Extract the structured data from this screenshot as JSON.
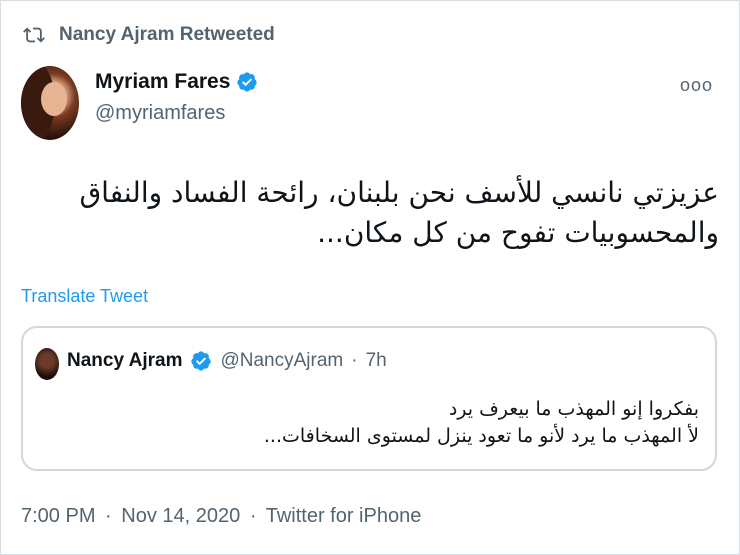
{
  "retweet_header": {
    "icon": "retweet-icon",
    "label": "Nancy Ajram Retweeted"
  },
  "author": {
    "display_name": "Myriam Fares",
    "handle": "@myriamfares",
    "verified": true
  },
  "more_menu": "ooo",
  "tweet": {
    "lines": [
      "عزيزتي نانسي للأسف نحن بلبنان، رائحة الفساد والنفاق",
      "والمحسوبيات تفوح من كل مكان..."
    ]
  },
  "translate_label": "Translate Tweet",
  "quoted_tweet": {
    "display_name": "Nancy Ajram",
    "handle": "@NancyAjram",
    "separator": "·",
    "time": "7h",
    "lines": [
      "بفكروا إنو المهذب ما بيعرف يرد",
      "لأ المهذب ما يرد لأنو ما تعود ينزل لمستوى السخافات..."
    ]
  },
  "meta": {
    "time": "7:00 PM",
    "date": "Nov 14, 2020",
    "source": "Twitter for iPhone",
    "separator": "·"
  },
  "colors": {
    "accent": "#1d9bf0",
    "secondary_text": "#536471",
    "primary_text": "#0f1419",
    "border": "#cfd9de"
  }
}
